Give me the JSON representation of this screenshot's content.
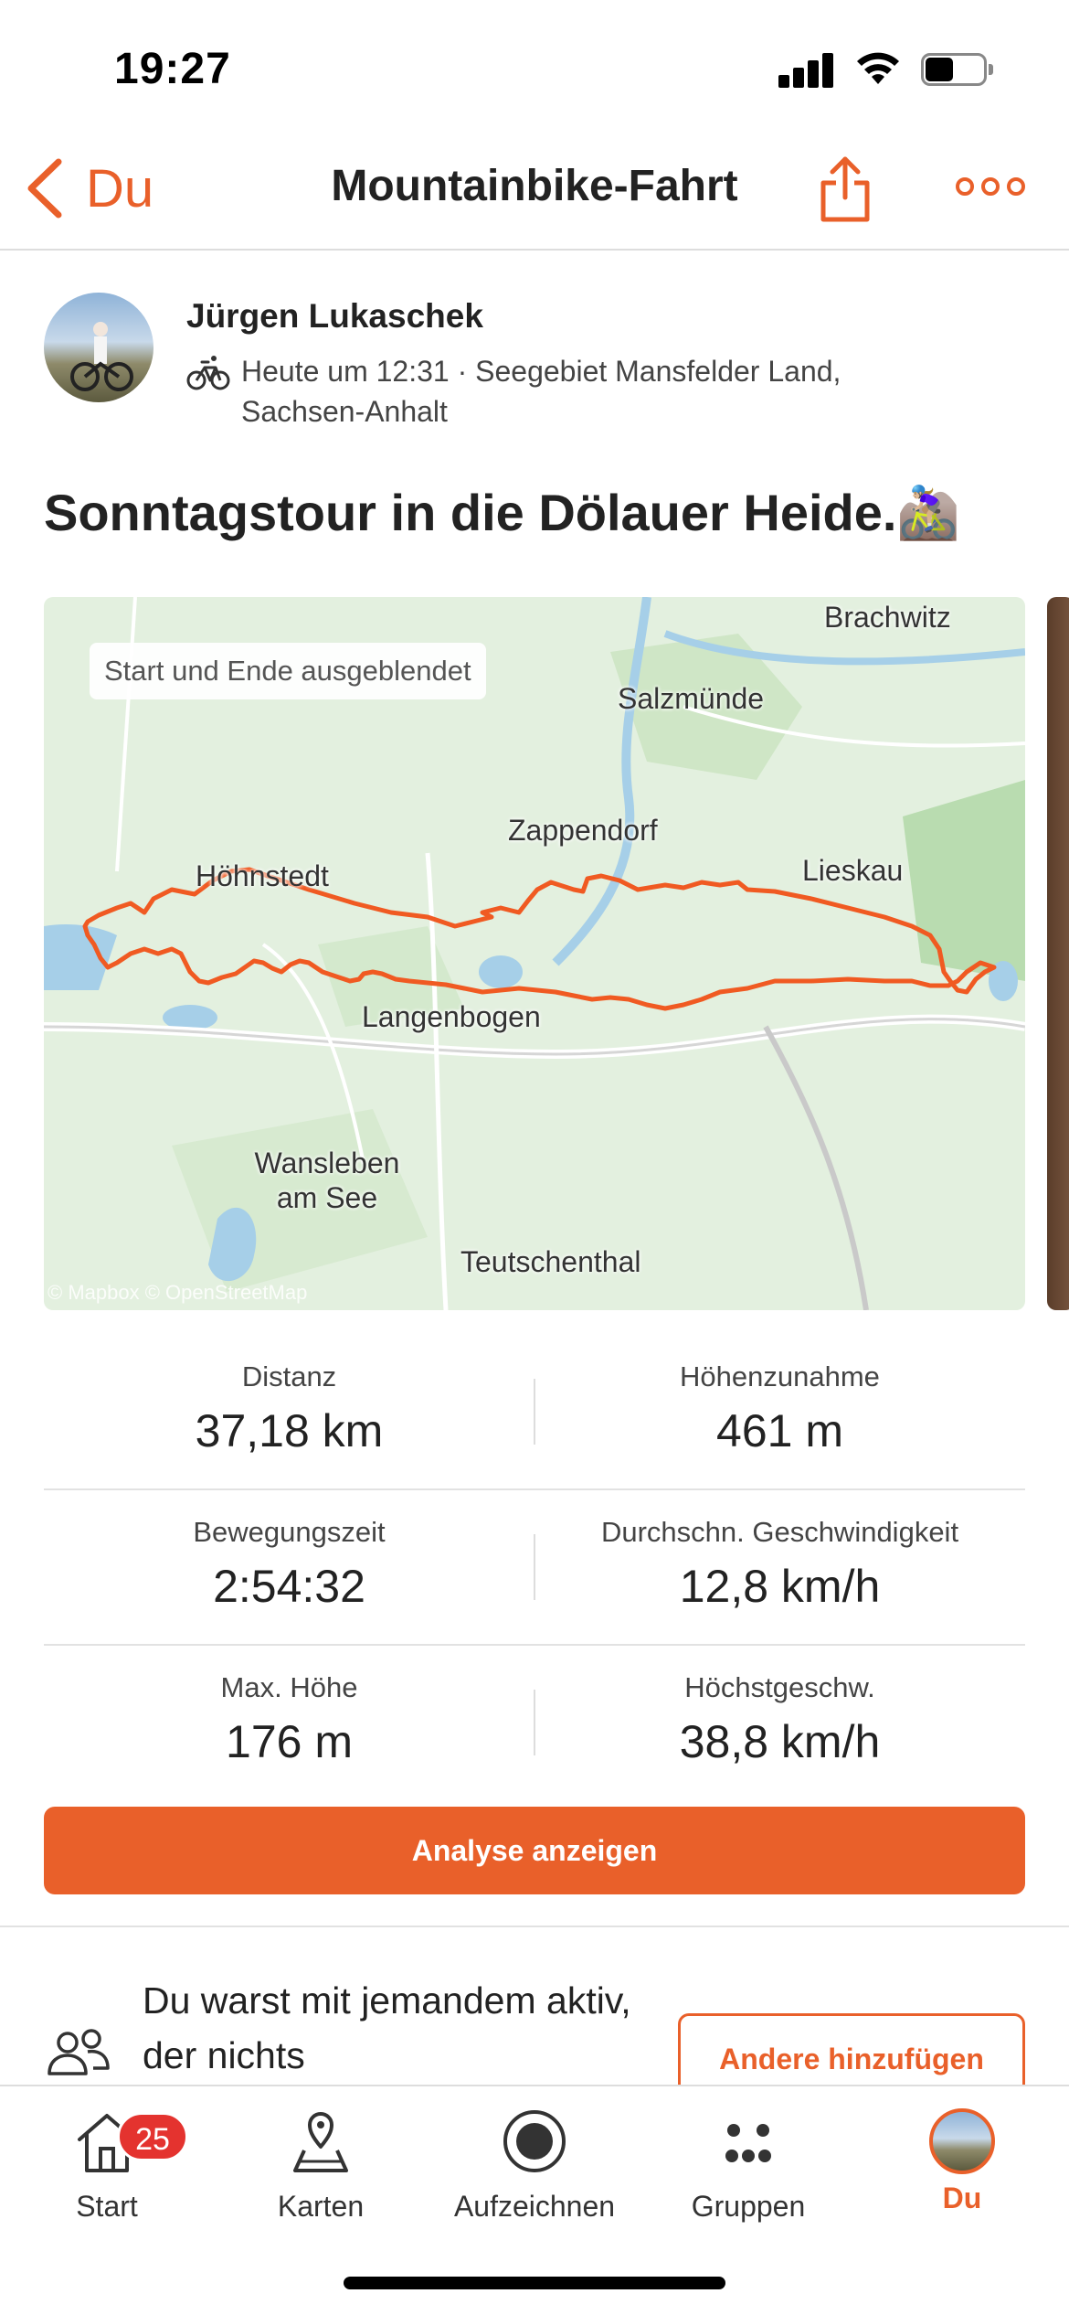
{
  "status_bar": {
    "time": "19:27"
  },
  "nav": {
    "back_label": "Du",
    "title": "Mountainbike-Fahrt"
  },
  "athlete": {
    "name": "Jürgen Lukaschek",
    "meta": "Heute um 12:31 · Seegebiet Mansfelder Land, Sachsen-Anhalt"
  },
  "activity": {
    "title": "Sonntagstour in die Dölauer Heide.🚵🏼‍♀️"
  },
  "map": {
    "badge": "Start und Ende ausgeblendet",
    "labels": {
      "brachwitz": "Brachwitz",
      "salzmuende": "Salzmünde",
      "zappendorf": "Zappendorf",
      "lieskau": "Lieskau",
      "hoehnstedt": "Höhnstedt",
      "langenbogen": "Langenbogen",
      "wansleben": "Wansleben am See",
      "teutschenthal": "Teutschenthal"
    },
    "credit": "© Mapbox © OpenStreetMap",
    "route_color": "#f05a22"
  },
  "stats": [
    {
      "left": {
        "label": "Distanz",
        "value": "37,18 km"
      },
      "right": {
        "label": "Höhenzunahme",
        "value": "461 m"
      }
    },
    {
      "left": {
        "label": "Bewegungszeit",
        "value": "2:54:32"
      },
      "right": {
        "label": "Durchschn. Geschwindigkeit",
        "value": "12,8 km/h"
      }
    },
    {
      "left": {
        "label": "Max. Höhe",
        "value": "176 m"
      },
      "right": {
        "label": "Höchstgeschw.",
        "value": "38,8 km/h"
      }
    }
  ],
  "analyse_button": "Analyse anzeigen",
  "together": {
    "text": "Du warst mit jemandem aktiv, der nichts",
    "button": "Andere hinzufügen"
  },
  "tabbar": {
    "start": "Start",
    "start_badge": "25",
    "karten": "Karten",
    "aufzeichnen": "Aufzeichnen",
    "gruppen": "Gruppen",
    "du": "Du"
  },
  "colors": {
    "accent": "#e9602a",
    "badge": "#e4332f"
  },
  "icons": [
    "back-chevron-icon",
    "share-icon",
    "more-icon",
    "bike-icon",
    "people-icon",
    "home-icon",
    "map-icon",
    "record-icon",
    "groups-icon"
  ]
}
